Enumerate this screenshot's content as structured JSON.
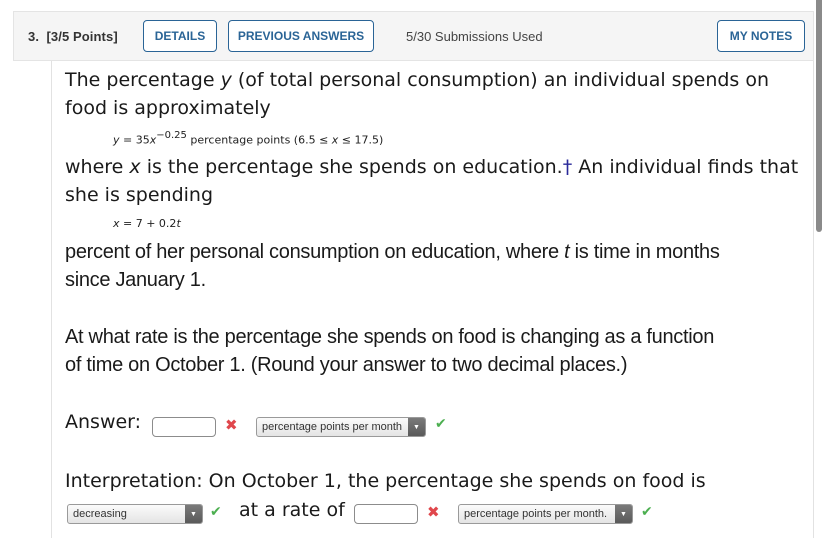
{
  "header": {
    "question_number": "3.",
    "points": "[3/5 Points]",
    "details_label": "DETAILS",
    "previous_answers_label": "PREVIOUS ANSWERS",
    "submissions": "5/30 Submissions Used",
    "my_notes_label": "MY NOTES"
  },
  "question": {
    "p1_a": "The percentage ",
    "p1_var": "y",
    "p1_b": " (of total personal consumption) an individual spends on",
    "p1_line2": "food is approximately",
    "formula1": {
      "lhs": "y",
      "eq": " = 35",
      "var": "x",
      "exponent": "−0.25",
      "rest": " percentage points  (6.5 ≤ ",
      "var2": "x",
      "rest2": " ≤ 17.5)"
    },
    "p2_a": "where ",
    "p2_var": "x",
    "p2_b": " is the percentage she spends on education.",
    "p2_dagger": "†",
    "p2_c": " An individual finds that",
    "p2_line2": "she is spending",
    "formula2": {
      "lhs": "x",
      "rest": " = 7 + 0.2",
      "var": "t"
    },
    "p3_a": "percent of her personal consumption on education, where ",
    "p3_var": "t",
    "p3_b": " is time in months",
    "p3_line2": "since January 1.",
    "p4_line1": "At what rate is the percentage she spends on food is changing as a function",
    "p4_line2": "of time on October 1. (Round your answer to two decimal places.)"
  },
  "answer": {
    "label": "Answer:",
    "value": "",
    "status": "incorrect",
    "unit_select": "percentage points per month",
    "unit_status": "correct"
  },
  "interpretation": {
    "line1": "Interpretation: On October 1, the percentage she spends on food is",
    "direction_select": "decreasing",
    "direction_status": "correct",
    "at_rate_of": "at a rate of",
    "rate_value": "",
    "rate_status": "incorrect",
    "unit_select": "percentage points per month.",
    "unit_status": "correct"
  },
  "icons": {
    "incorrect": "✖",
    "correct": "✔",
    "dropdown_arrow": "▼"
  },
  "colors": {
    "accent": "#2a6496",
    "incorrect": "#e0474c",
    "correct": "#4caf50",
    "dagger": "#2a2a9a"
  }
}
